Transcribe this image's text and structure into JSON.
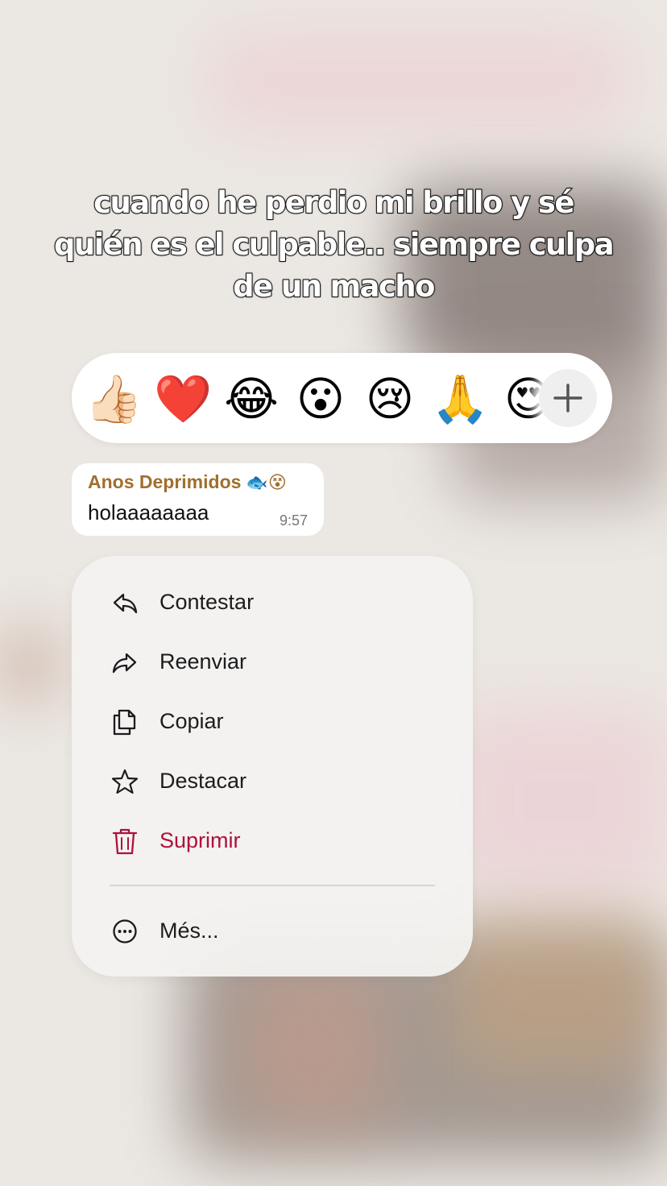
{
  "caption": "cuando he perdio mi brillo y sé quién es el culpable.. siempre culpa de un macho",
  "reactions": [
    "👍🏻",
    "❤️",
    "😂",
    "😮",
    "😢",
    "🙏",
    "😍"
  ],
  "message": {
    "sender": "Anos Deprimidos",
    "sender_emojis": "🐟😵",
    "text": "holaaaaaaaa",
    "time": "9:57"
  },
  "menu": {
    "items": [
      {
        "label": "Contestar",
        "icon": "reply-icon"
      },
      {
        "label": "Reenviar",
        "icon": "forward-icon"
      },
      {
        "label": "Copiar",
        "icon": "copy-icon"
      },
      {
        "label": "Destacar",
        "icon": "star-icon"
      },
      {
        "label": "Suprimir",
        "icon": "trash-icon"
      }
    ],
    "more": {
      "label": "Més...",
      "icon": "more-icon"
    }
  },
  "colors": {
    "sender": "#a06f2e",
    "danger": "#b0103a",
    "menu_bg": "#f3f2f0",
    "background": "#ebe7e2"
  }
}
